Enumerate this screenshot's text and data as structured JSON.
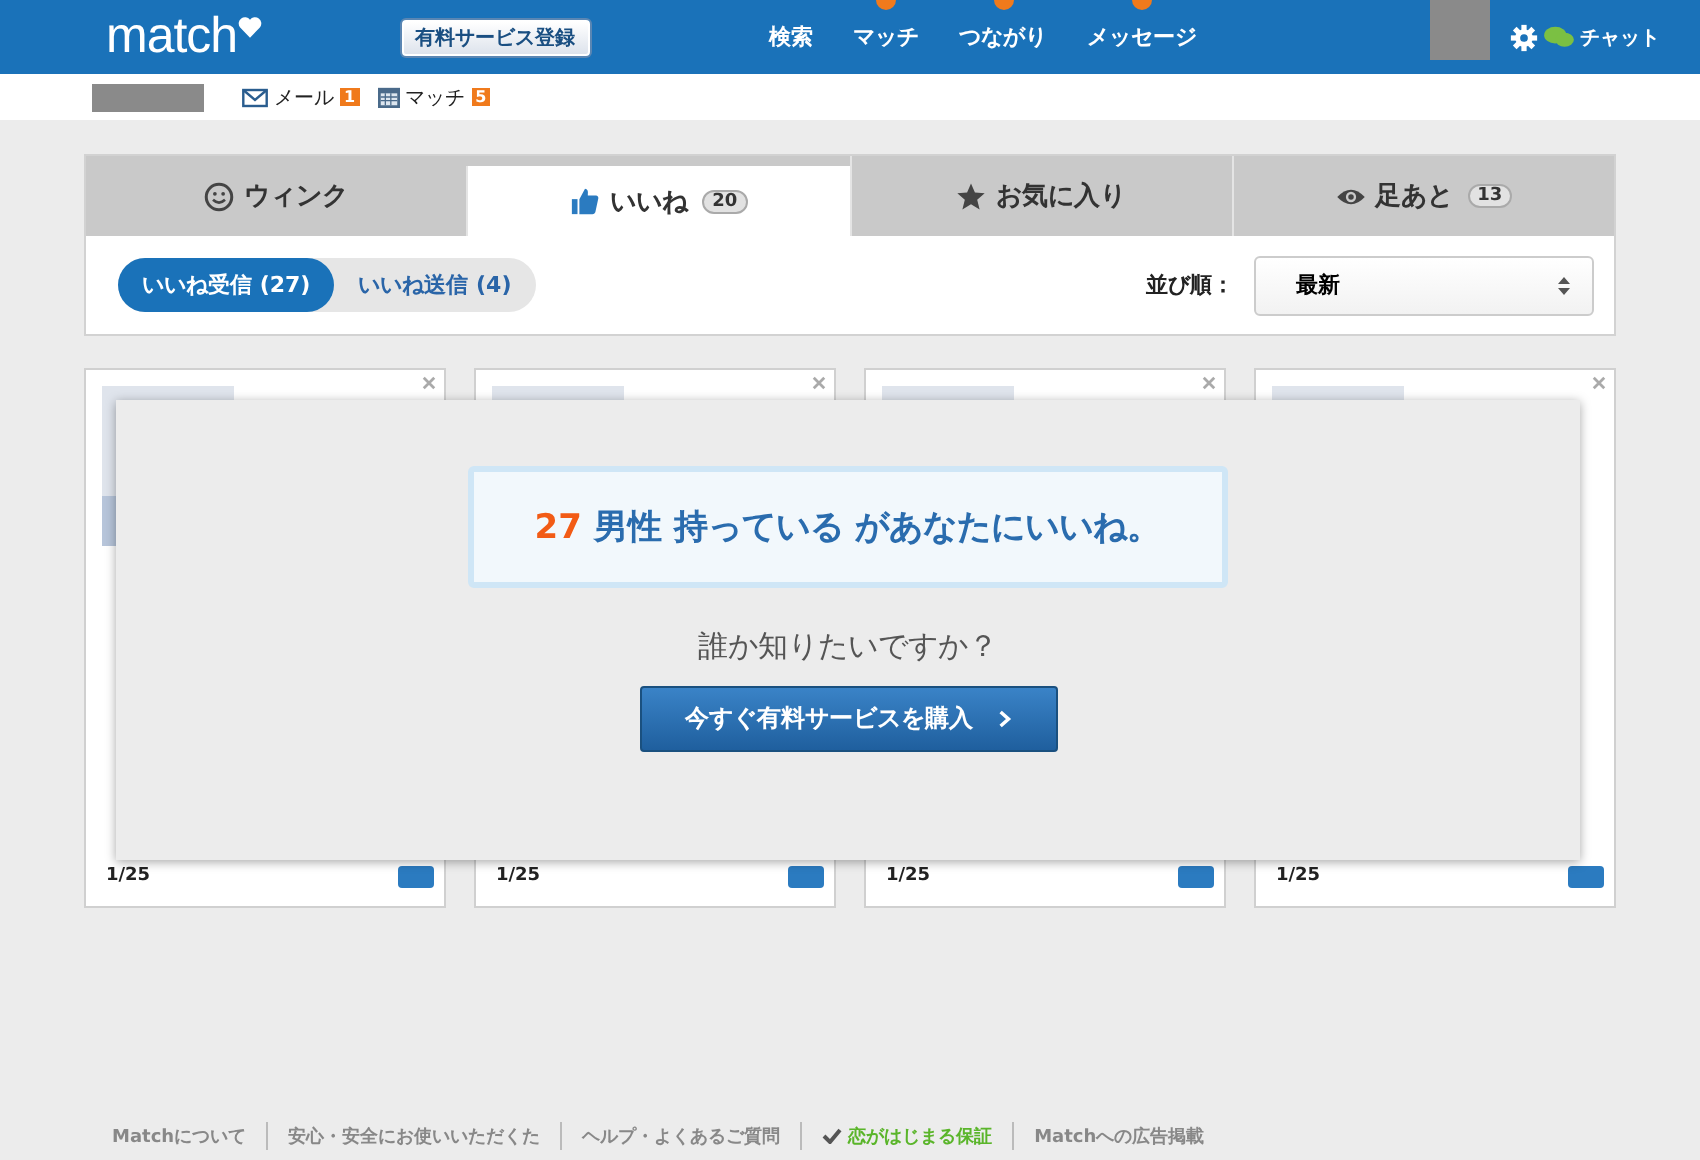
{
  "header": {
    "logo": "match",
    "register_button": "有料サービス登録",
    "nav": [
      {
        "label": "検索",
        "dot": false
      },
      {
        "label": "マッチ",
        "dot": true
      },
      {
        "label": "つながり",
        "dot": true
      },
      {
        "label": "メッセージ",
        "dot": true
      }
    ],
    "chat": "チャット"
  },
  "subnav": [
    {
      "label": "メール",
      "count": "1",
      "kind": "mail"
    },
    {
      "label": "マッチ",
      "count": "5",
      "kind": "calendar"
    }
  ],
  "tabs": [
    {
      "label": "ウィンク",
      "kind": "smile",
      "selected": false
    },
    {
      "label": "いいね",
      "count": "20",
      "kind": "thumb",
      "selected": true
    },
    {
      "label": "お気に入り",
      "kind": "star",
      "selected": false
    },
    {
      "label": "足あと",
      "count": "13",
      "kind": "eye",
      "selected": false
    }
  ],
  "toggle": [
    {
      "label": "いいね受信 (27)",
      "selected": true
    },
    {
      "label": "いいね送信 (4)",
      "selected": false
    }
  ],
  "sort": {
    "label": "並び順：",
    "value": "最新"
  },
  "cards": [
    {
      "page": "1/25"
    },
    {
      "page": "1/25"
    },
    {
      "page": "1/25"
    },
    {
      "page": "1/25"
    }
  ],
  "overlay": {
    "count": "27",
    "headline": "男性 持っている があなたにいいね。",
    "question": "誰か知りたいですか？",
    "button": "今すぐ有料サービスを購入"
  },
  "footer": [
    {
      "label": "Matchについて",
      "kind": "link"
    },
    {
      "label": "安心・安全にお使いいただくた",
      "kind": "link"
    },
    {
      "label": "ヘルプ・よくあるご質問",
      "kind": "link"
    },
    {
      "label": "恋がはじまる保証",
      "kind": "guarantee"
    },
    {
      "label": "Matchへの広告掲載",
      "kind": "link"
    }
  ]
}
